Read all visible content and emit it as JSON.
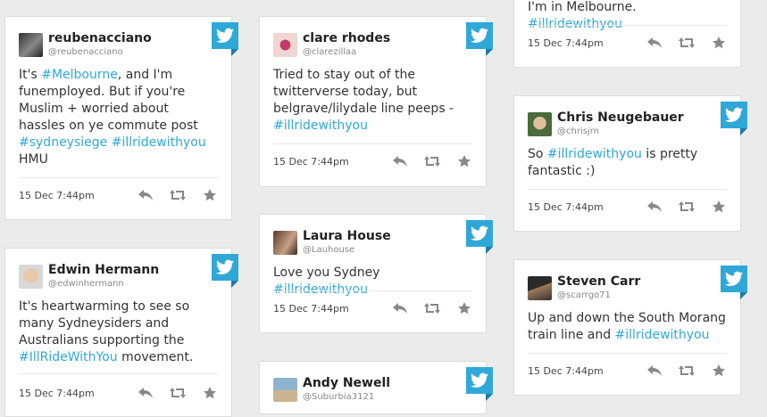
{
  "tweets": [
    {
      "name": "reubenacciano",
      "handle": "@reubenacciano",
      "parts": [
        "It's ",
        "#Melbourne",
        ", and I'm funemployed. But if you're Muslim + worried about hassles on ye commute post ",
        "#sydneysiege",
        " ",
        "#illridewithyou",
        " HMU"
      ],
      "date": "15 Dec 7:44pm"
    },
    {
      "name": "Edwin Hermann",
      "handle": "@edwinhermann",
      "parts": [
        "It's heartwarming to see so many Sydneysiders and Australians supporting the ",
        "#IllRideWithYou",
        " movement."
      ],
      "date": "15 Dec 7:44pm"
    },
    {
      "name": "clare rhodes",
      "handle": "@clarezillaa",
      "parts": [
        "Tried to stay out of the twitterverse today, but belgrave/lilydale line peeps - ",
        "#illridewithyou"
      ],
      "date": "15 Dec 7:44pm"
    },
    {
      "name": "Laura House",
      "handle": "@Lauhouse",
      "parts": [
        "Love you Sydney ",
        "#illridewithyou"
      ],
      "date": "15 Dec 7:44pm"
    },
    {
      "name": "Andy Newell",
      "handle": "@Suburbia3121"
    },
    {
      "parts": [
        "I'm in Melbourne. ",
        "#illridewithyou"
      ],
      "date": "15 Dec 7:44pm"
    },
    {
      "name": "Chris Neugebauer",
      "handle": "@chrisjrn",
      "parts": [
        "So ",
        "#illridewithyou",
        " is pretty fantastic :)"
      ],
      "date": "15 Dec 7:44pm"
    },
    {
      "name": "Steven Carr",
      "handle": "@scarrgo71",
      "parts": [
        "Up and down the South Morang train line and ",
        "#illridewithyou"
      ],
      "date": "15 Dec 7:44pm"
    }
  ],
  "icons": {
    "badge": "twitter-bird-icon",
    "reply": "reply-icon",
    "retweet": "retweet-icon",
    "favorite": "star-icon"
  },
  "colors": {
    "accent": "#2fa8d8",
    "background": "#ebebeb"
  }
}
